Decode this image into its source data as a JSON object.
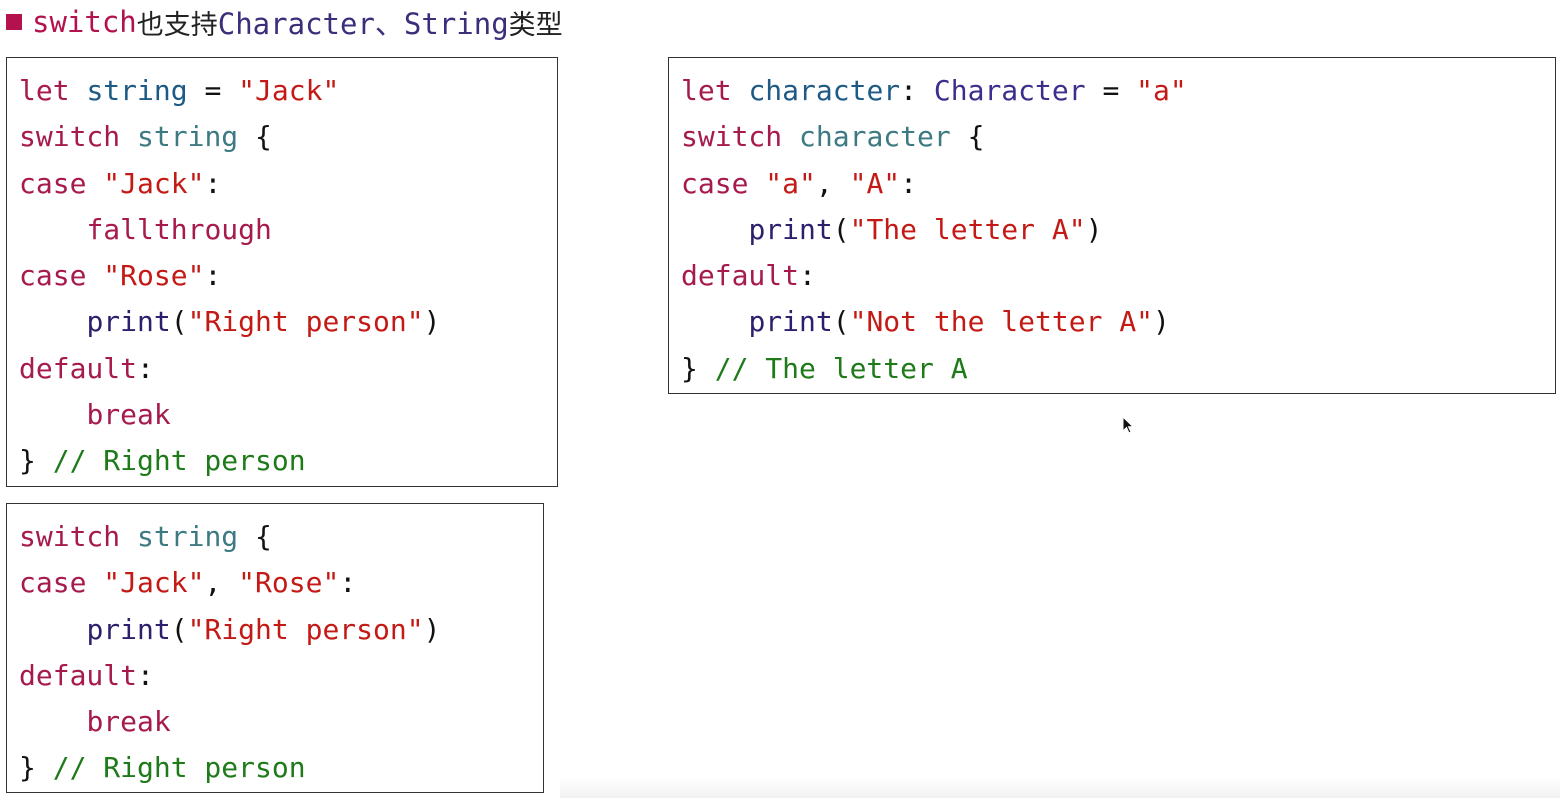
{
  "heading": {
    "prefix": "switch",
    "middle": "也支持",
    "types": "Character、String",
    "suffix": "类型"
  },
  "colors": {
    "bullet": "#b3124e",
    "keyword": "#a61a4e",
    "string": "#c41a16",
    "comment": "#1f7a1a",
    "identifier": "#1e5a86",
    "function": "#2e1f6e"
  },
  "cursor_icon": "arrow-cursor-icon",
  "code_blocks": [
    {
      "lines": [
        [
          [
            "kw",
            "let"
          ],
          [
            "pn",
            " "
          ],
          [
            "ident",
            "string"
          ],
          [
            "pn",
            " = "
          ],
          [
            "str",
            "\"Jack\""
          ]
        ],
        [
          [
            "kw",
            "switch"
          ],
          [
            "pn",
            " "
          ],
          [
            "var",
            "string"
          ],
          [
            "pn",
            " {"
          ]
        ],
        [
          [
            "kw",
            "case"
          ],
          [
            "pn",
            " "
          ],
          [
            "str",
            "\"Jack\""
          ],
          [
            "pn",
            ":"
          ]
        ],
        [
          [
            "pn",
            "    "
          ],
          [
            "kw",
            "fallthrough"
          ]
        ],
        [
          [
            "kw",
            "case"
          ],
          [
            "pn",
            " "
          ],
          [
            "str",
            "\"Rose\""
          ],
          [
            "pn",
            ":"
          ]
        ],
        [
          [
            "pn",
            "    "
          ],
          [
            "fn",
            "print"
          ],
          [
            "pn",
            "("
          ],
          [
            "str",
            "\"Right person\""
          ],
          [
            "pn",
            ")"
          ]
        ],
        [
          [
            "kw",
            "default"
          ],
          [
            "pn",
            ":"
          ]
        ],
        [
          [
            "pn",
            "    "
          ],
          [
            "kw",
            "break"
          ]
        ],
        [
          [
            "pn",
            "} "
          ],
          [
            "cm",
            "// Right person"
          ]
        ]
      ]
    },
    {
      "lines": [
        [
          [
            "kw",
            "switch"
          ],
          [
            "pn",
            " "
          ],
          [
            "var",
            "string"
          ],
          [
            "pn",
            " {"
          ]
        ],
        [
          [
            "kw",
            "case"
          ],
          [
            "pn",
            " "
          ],
          [
            "str",
            "\"Jack\""
          ],
          [
            "pn",
            ", "
          ],
          [
            "str",
            "\"Rose\""
          ],
          [
            "pn",
            ":"
          ]
        ],
        [
          [
            "pn",
            "    "
          ],
          [
            "fn",
            "print"
          ],
          [
            "pn",
            "("
          ],
          [
            "str",
            "\"Right person\""
          ],
          [
            "pn",
            ")"
          ]
        ],
        [
          [
            "kw",
            "default"
          ],
          [
            "pn",
            ":"
          ]
        ],
        [
          [
            "pn",
            "    "
          ],
          [
            "kw",
            "break"
          ]
        ],
        [
          [
            "pn",
            "} "
          ],
          [
            "cm",
            "// Right person"
          ]
        ]
      ]
    },
    {
      "lines": [
        [
          [
            "kw",
            "let"
          ],
          [
            "pn",
            " "
          ],
          [
            "ident",
            "character"
          ],
          [
            "pn",
            ": "
          ],
          [
            "type",
            "Character"
          ],
          [
            "pn",
            " = "
          ],
          [
            "str",
            "\"a\""
          ]
        ],
        [
          [
            "kw",
            "switch"
          ],
          [
            "pn",
            " "
          ],
          [
            "var",
            "character"
          ],
          [
            "pn",
            " {"
          ]
        ],
        [
          [
            "kw",
            "case"
          ],
          [
            "pn",
            " "
          ],
          [
            "str",
            "\"a\""
          ],
          [
            "pn",
            ", "
          ],
          [
            "str",
            "\"A\""
          ],
          [
            "pn",
            ":"
          ]
        ],
        [
          [
            "pn",
            "    "
          ],
          [
            "fn",
            "print"
          ],
          [
            "pn",
            "("
          ],
          [
            "str",
            "\"The letter A\""
          ],
          [
            "pn",
            ")"
          ]
        ],
        [
          [
            "kw",
            "default"
          ],
          [
            "pn",
            ":"
          ]
        ],
        [
          [
            "pn",
            "    "
          ],
          [
            "fn",
            "print"
          ],
          [
            "pn",
            "("
          ],
          [
            "str",
            "\"Not the letter A\""
          ],
          [
            "pn",
            ")"
          ]
        ],
        [
          [
            "pn",
            "} "
          ],
          [
            "cm",
            "// The letter A"
          ]
        ]
      ]
    }
  ]
}
